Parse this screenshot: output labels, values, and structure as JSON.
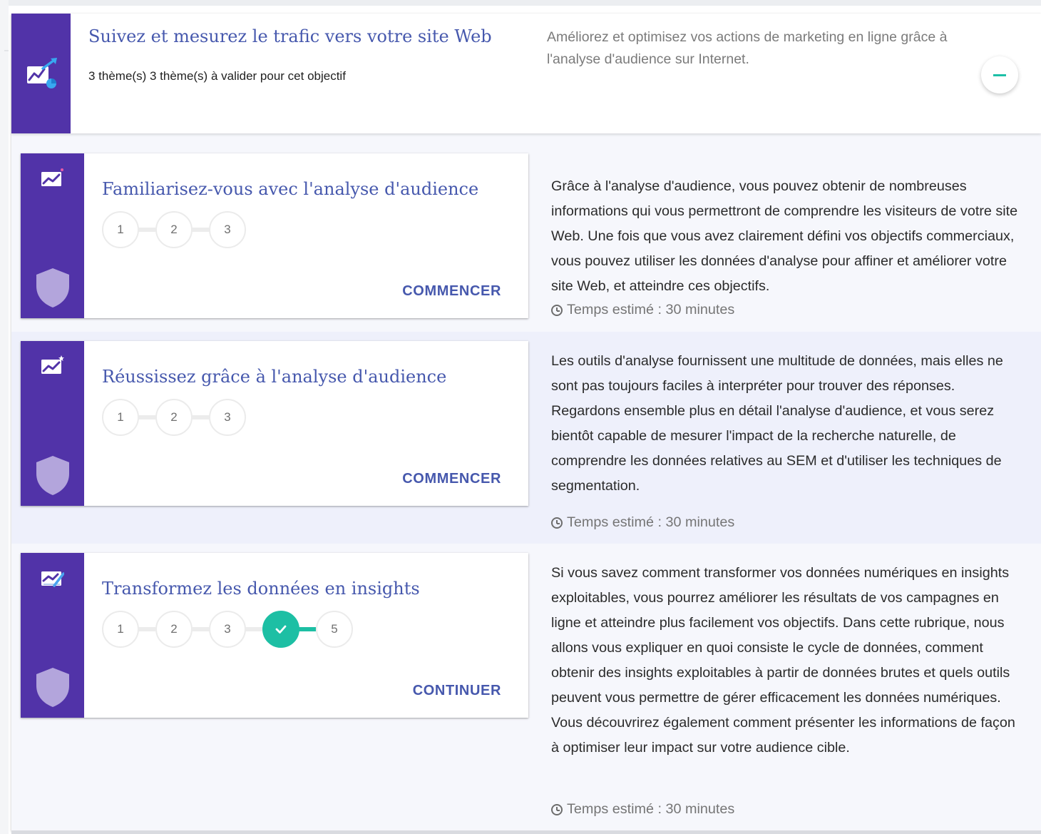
{
  "colors": {
    "accent_purple": "#5133a8",
    "link_blue": "#4658ad",
    "teal": "#1dbfa4",
    "shield": "#b3a5dc"
  },
  "objective": {
    "title": "Suivez et mesurez le trafic vers votre site Web",
    "subtitle": "3 thème(s) 3 thème(s) à valider pour cet objectif",
    "description": "Améliorez et optimisez vos actions de marketing en ligne grâce à l'analyse d'audience sur Internet.",
    "icon": "trend-chart-icon",
    "collapse_icon": "minus-icon"
  },
  "modules": [
    {
      "title": "Familiarisez-vous avec l'analyse d'audience",
      "steps": [
        "1",
        "2",
        "3"
      ],
      "button": "COMMENCER",
      "description": "Grâce à l'analyse d'audience, vous pouvez obtenir de nombreuses informations qui vous permettront de comprendre les visiteurs de votre site Web. Une fois que vous avez clairement défini vos objectifs commerciaux, vous pouvez utiliser les données d'analyse pour affiner et améliorer votre site Web, et atteindre ces objectifs.",
      "time": "Temps estimé : 30 minutes"
    },
    {
      "title": "Réussissez grâce à l'analyse d'audience",
      "steps": [
        "1",
        "2",
        "3"
      ],
      "button": "COMMENCER",
      "description": "Les outils d'analyse fournissent une multitude de données, mais elles ne sont pas toujours faciles à interpréter pour trouver des réponses. Regardons ensemble plus en détail l'analyse d'audience, et vous serez bientôt capable de mesurer l'impact de la recherche naturelle, de comprendre les données relatives au SEM et d'utiliser les techniques de segmentation.",
      "time": "Temps estimé : 30 minutes"
    },
    {
      "title": "Transformez les données en insights",
      "steps": [
        "1",
        "2",
        "3",
        "",
        "5"
      ],
      "step_done_icon": "check-icon",
      "button": "CONTINUER",
      "description": "Si vous savez comment transformer vos données numériques en insights exploitables, vous pourrez améliorer les résultats de vos campagnes en ligne et atteindre plus facilement vos objectifs. Dans cette rubrique, nous allons vous expliquer en quoi consiste le cycle de données, comment obtenir des insights exploitables à partir de données brutes et quels outils peuvent vous permettre de gérer efficacement les données numériques. Vous découvrirez également comment présenter les informations de façon à optimiser leur impact sur votre audience cible.",
      "time": "Temps estimé : 30 minutes"
    }
  ]
}
